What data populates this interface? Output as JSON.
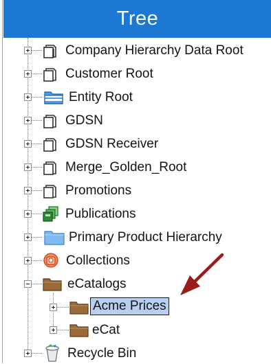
{
  "panel": {
    "title": "Tree"
  },
  "tree": {
    "items": [
      {
        "label": "Company Hierarchy Data Root",
        "icon": "generic-node-icon"
      },
      {
        "label": "Customer Root",
        "icon": "generic-node-icon"
      },
      {
        "label": "Entity Root",
        "icon": "entity-folder-icon"
      },
      {
        "label": "GDSN",
        "icon": "generic-node-icon"
      },
      {
        "label": "GDSN Receiver",
        "icon": "generic-node-icon"
      },
      {
        "label": "Merge_Golden_Root",
        "icon": "generic-node-icon"
      },
      {
        "label": "Promotions",
        "icon": "generic-node-icon"
      },
      {
        "label": "Publications",
        "icon": "publications-icon"
      },
      {
        "label": "Primary Product Hierarchy",
        "icon": "blue-folder-icon"
      },
      {
        "label": "Collections",
        "icon": "collections-icon"
      },
      {
        "label": "eCatalogs",
        "icon": "brown-folder-icon",
        "expanded": true
      },
      {
        "label": "Acme Prices",
        "icon": "brown-folder-icon",
        "selected": true
      },
      {
        "label": "eCat",
        "icon": "brown-folder-icon"
      },
      {
        "label": "Recycle Bin",
        "icon": "recycle-bin-icon"
      }
    ]
  },
  "colors": {
    "header": "#1d78d3",
    "selection": "#b9cff0",
    "annotation_arrow": "#9b1b1b"
  }
}
